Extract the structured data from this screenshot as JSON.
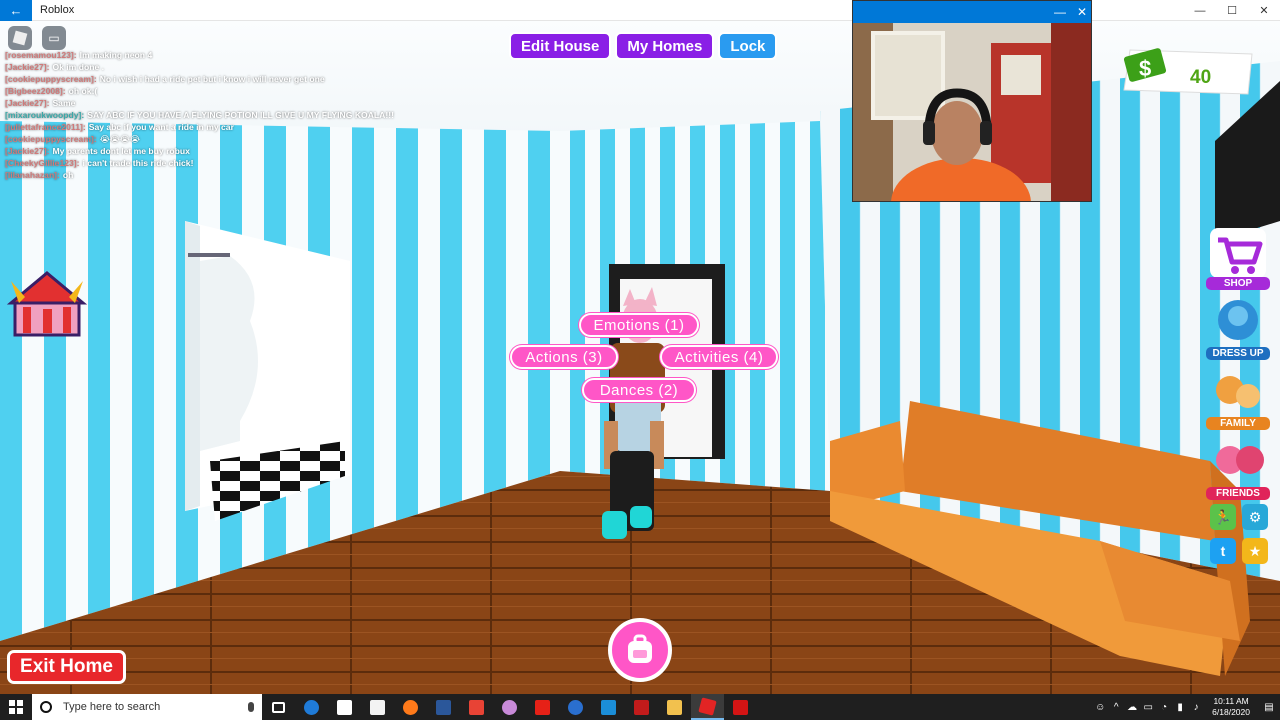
{
  "window": {
    "title": "Roblox"
  },
  "chat": {
    "messages": [
      {
        "user": "[rosemamou123]:",
        "text": "Im making neon 4",
        "color": "red"
      },
      {
        "user": "[Jackie27]:",
        "text": "Ok im done .",
        "color": "red"
      },
      {
        "user": "[cookiepuppyscream]:",
        "text": "No i wish i had a ride pet but i know i will never get one",
        "color": "red"
      },
      {
        "user": "[Bigbeez2008]:",
        "text": "oh ok:(",
        "color": "red"
      },
      {
        "user": "[Jackie27]:",
        "text": "Same",
        "color": "red"
      },
      {
        "user": "[mixaroukwoopdy]:",
        "text": "SAY ABC IF YOU HAVE A FLYING POTION ILL GIVE U MY FLYING KOALA!!!",
        "color": "teal"
      },
      {
        "user": "[juliettafrance2011]:",
        "text": "Say abc if you want a ride in my car",
        "color": "red"
      },
      {
        "user": "[cookiepuppyscream]:",
        "text": "😭😭😭😭",
        "color": "red"
      },
      {
        "user": "[Jackie27]:",
        "text": "My parents dont let me buy robux",
        "color": "red"
      },
      {
        "user": "[CheekyGillie123]:",
        "text": "i can't trade this ride chick!",
        "color": "red"
      },
      {
        "user": "[lilanahazan]:",
        "text": "oh",
        "color": "red"
      }
    ]
  },
  "top_buttons": {
    "edit_house": "Edit House",
    "my_homes": "My Homes",
    "lock": "Lock"
  },
  "money": {
    "amount": "40"
  },
  "side_menu": {
    "shop": "SHOP",
    "dress_up": "DRESS UP",
    "family": "FAMILY",
    "friends": "FRIENDS"
  },
  "interaction_menu": {
    "emotions": "Emotions (1)",
    "actions": "Actions (3)",
    "activities": "Activities (4)",
    "dances": "Dances (2)"
  },
  "exit_home": "Exit Home",
  "taskbar": {
    "search_placeholder": "Type here to search",
    "time": "10:11 AM",
    "date": "6/18/2020"
  },
  "colors": {
    "accent_purple": "#8a1fe6",
    "accent_blue": "#2a9bf0",
    "pill_pink": "#ff56c7",
    "exit_red": "#e8272b",
    "money_green": "#4fa514",
    "stripe_blue": "#4fd0f0"
  }
}
